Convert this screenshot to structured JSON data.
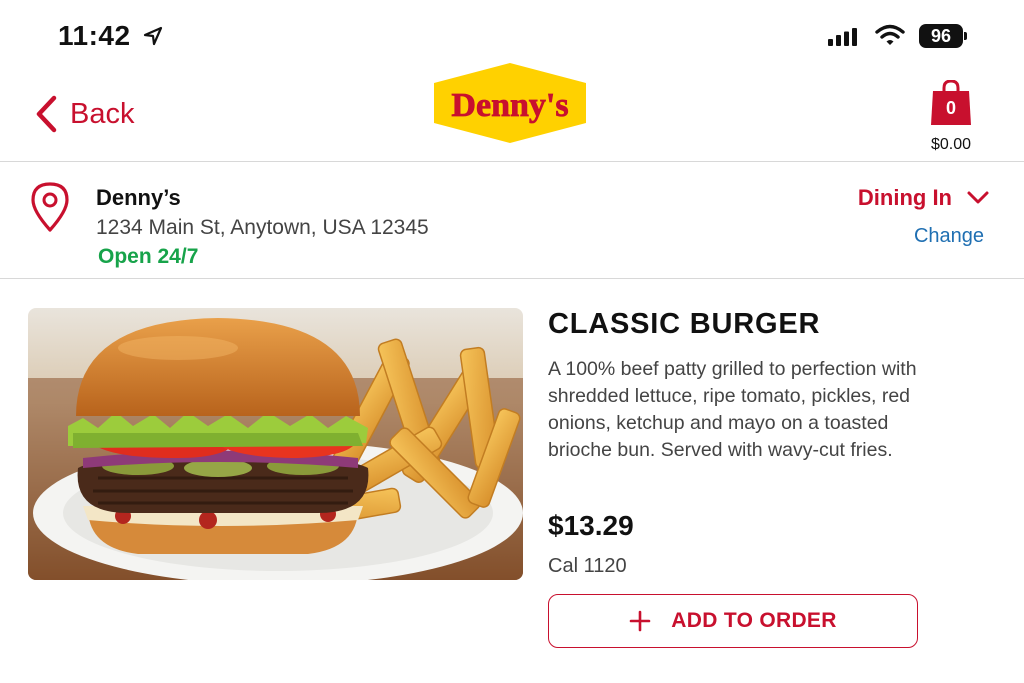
{
  "status_bar": {
    "time": "11:42",
    "battery": "96",
    "icons": [
      "location-arrow-icon",
      "cellular-signal-icon",
      "wifi-icon",
      "battery-icon"
    ]
  },
  "header": {
    "back_label": "Back",
    "logo_text": "Denny's",
    "cart": {
      "count": "0",
      "total": "$0.00"
    }
  },
  "location": {
    "name": "Denny’s",
    "address": "1234 Main St, Anytown, USA 12345",
    "hours": "Open 24/7",
    "dining_mode": "Dining In",
    "change_label": "Change"
  },
  "product": {
    "title": "CLASSIC BURGER",
    "description": "A 100% beef patty grilled to perfection with shredded lettuce, ripe tomato, pickles, red onions, ketchup and mayo on a toasted brioche bun. Served with wavy-cut fries.",
    "price": "$13.29",
    "calories": "Cal 1120",
    "add_label": "ADD TO ORDER"
  },
  "colors": {
    "brand_red": "#c8102e",
    "logo_yellow": "#ffd100",
    "open_green": "#17a34a",
    "link_blue": "#1f6fb2"
  }
}
